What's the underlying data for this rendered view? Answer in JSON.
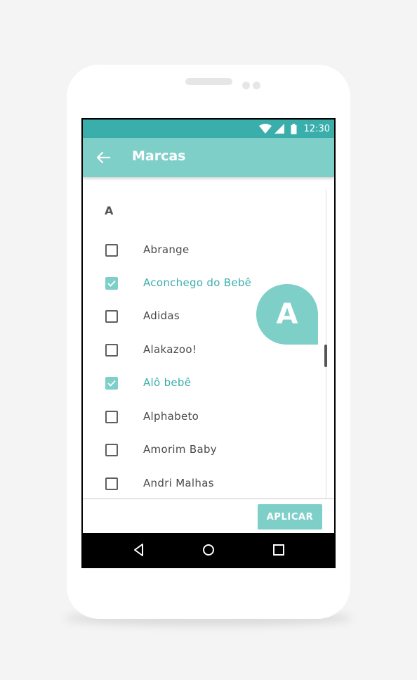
{
  "status_bar": {
    "time": "12:30"
  },
  "app_bar": {
    "title": "Marcas",
    "back_icon": "arrow-left-icon"
  },
  "list": {
    "section_letter": "A",
    "index_bubble_letter": "A",
    "items": [
      {
        "label": "Abrange",
        "checked": false
      },
      {
        "label": "Aconchego do Bebê",
        "checked": true
      },
      {
        "label": "Adidas",
        "checked": false
      },
      {
        "label": "Alakazoo!",
        "checked": false
      },
      {
        "label": "Alô bebê",
        "checked": true
      },
      {
        "label": "Alphabeto",
        "checked": false
      },
      {
        "label": "Amorim Baby",
        "checked": false
      },
      {
        "label": "Andri Malhas",
        "checked": false
      }
    ]
  },
  "footer": {
    "apply_label": "APLICAR"
  },
  "colors": {
    "status_bar": "#3aaeab",
    "accent": "#7fcfc9",
    "checked_text": "#3aaeab"
  }
}
